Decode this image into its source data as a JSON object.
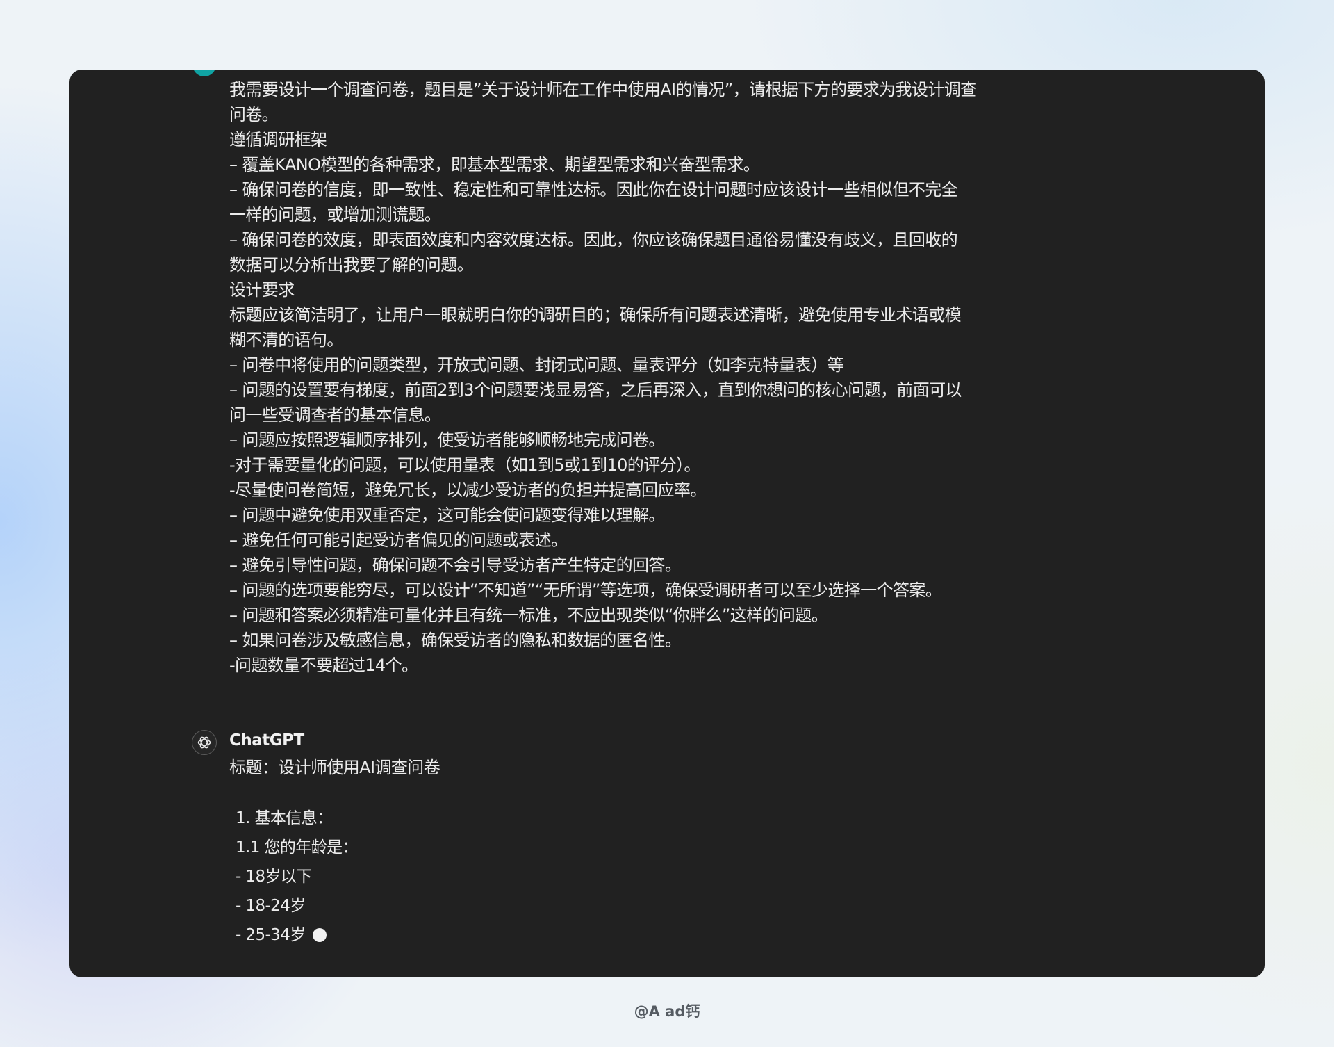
{
  "conversation": {
    "user_message_lines": [
      "我需要设计一个调查问卷，题目是”关于设计师在工作中使用AI的情况”，请根据下方的要求为我设计调查",
      "问卷。",
      "遵循调研框架",
      "– 覆盖KANO模型的各种需求，即基本型需求、期望型需求和兴奋型需求。",
      "– 确保问卷的信度，即一致性、稳定性和可靠性达标。因此你在设计问题时应该设计一些相似但不完全",
      "一样的问题，或增加测谎题。",
      "– 确保问卷的效度，即表面效度和内容效度达标。因此，你应该确保题目通俗易懂没有歧义，且回收的",
      "数据可以分析出我要了解的问题。",
      "设计要求",
      "标题应该简洁明了，让用户一眼就明白你的调研目的；确保所有问题表述清晰，避免使用专业术语或模",
      "糊不清的语句。",
      "– 问卷中将使用的问题类型，开放式问题、封闭式问题、量表评分（如李克特量表）等",
      "– 问题的设置要有梯度，前面2到3个问题要浅显易答，之后再深入，直到你想问的核心问题，前面可以",
      "问一些受调查者的基本信息。",
      "– 问题应按照逻辑顺序排列，使受访者能够顺畅地完成问卷。",
      "-对于需要量化的问题，可以使用量表（如1到5或1到10的评分）。",
      "-尽量使问卷简短，避免冗长，以减少受访者的负担并提高回应率。",
      "– 问题中避免使用双重否定，这可能会使问题变得难以理解。",
      "– 避免任何可能引起受访者偏见的问题或表述。",
      "– 避免引导性问题，确保问题不会引导受访者产生特定的回答。",
      "– 问题的选项要能穷尽，可以设计“不知道”“无所谓”等选项，确保受调研者可以至少选择一个答案。",
      "– 问题和答案必须精准可量化并且有统一标准，不应出现类似“你胖么”这样的问题。",
      "– 如果问卷涉及敏感信息，确保受访者的隐私和数据的匿名性。",
      "-问题数量不要超过14个。"
    ],
    "assistant_name": "ChatGPT",
    "assistant_title_line": "标题：设计师使用AI调查问卷",
    "assistant_items": [
      "1. 基本信息：",
      "1.1 您的年龄是：",
      "- 18岁以下",
      "- 18-24岁",
      "- 25-34岁"
    ]
  },
  "icons": {
    "user_avatar": "user-avatar-icon",
    "assistant_avatar": "openai-logo-icon",
    "streaming_cursor": "streaming-cursor-icon"
  },
  "colors": {
    "panel_background": "#212121",
    "user_avatar": "#10a3a3",
    "text": "#ececec"
  },
  "watermark": "@A ad钙"
}
